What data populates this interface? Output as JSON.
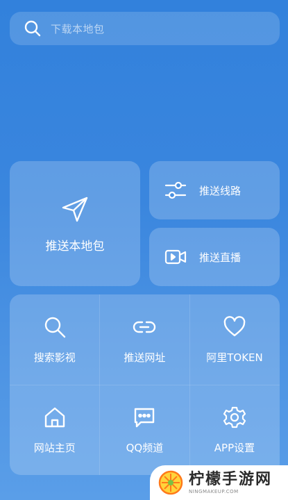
{
  "search": {
    "placeholder": "下载本地包"
  },
  "cards": {
    "push_local": "推送本地包",
    "push_route": "推送线路",
    "push_live": "推送直播"
  },
  "grid": [
    {
      "label": "搜索影视",
      "icon": "search-icon"
    },
    {
      "label": "推送网址",
      "icon": "link-icon"
    },
    {
      "label": "阿里TOKEN",
      "icon": "heart-icon"
    },
    {
      "label": "网站主页",
      "icon": "home-icon"
    },
    {
      "label": "QQ频道",
      "icon": "chat-icon"
    },
    {
      "label": "APP设置",
      "icon": "gear-icon"
    }
  ],
  "watermark": {
    "text": "柠檬手游网",
    "sub": "NINGMAKEUP.COM"
  },
  "colors": {
    "background": "#3a86de",
    "foreground": "#ffffff"
  }
}
